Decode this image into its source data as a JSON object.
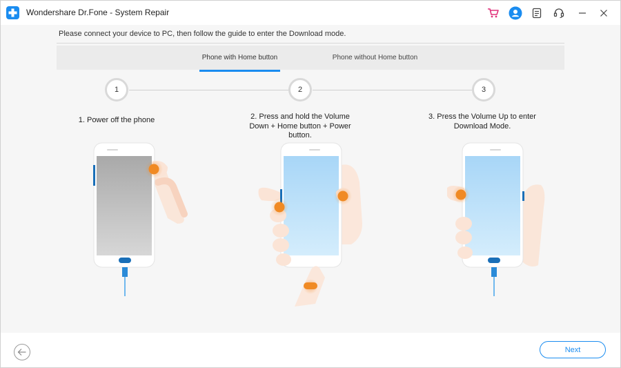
{
  "window": {
    "title": "Wondershare Dr.Fone - System Repair",
    "icons": [
      "cart-icon",
      "account-icon",
      "feedback-icon",
      "support-icon",
      "minimize-icon",
      "close-icon"
    ]
  },
  "main": {
    "instruction": "Please connect your device to PC, then follow the guide to enter the Download mode.",
    "tabs": [
      {
        "label": "Phone with Home button",
        "active": true
      },
      {
        "label": "Phone without Home button",
        "active": false
      }
    ],
    "steps": [
      {
        "number": "1",
        "text_lines": [
          "1. Power off the phone"
        ]
      },
      {
        "number": "2",
        "text_lines": [
          "2. Press and hold the Volume",
          "Down + Home button + Power",
          "button."
        ]
      },
      {
        "number": "3",
        "text_lines": [
          "3. Press the Volume Up to enter",
          "Download Mode."
        ]
      }
    ]
  },
  "footer": {
    "next_label": "Next"
  },
  "colors": {
    "accent": "#1a8cf0",
    "press_indicator": "#f08a24",
    "screen_off": "#bdbdbd",
    "screen_on": "#bfe3fb",
    "skin": "#fbe4d6"
  }
}
